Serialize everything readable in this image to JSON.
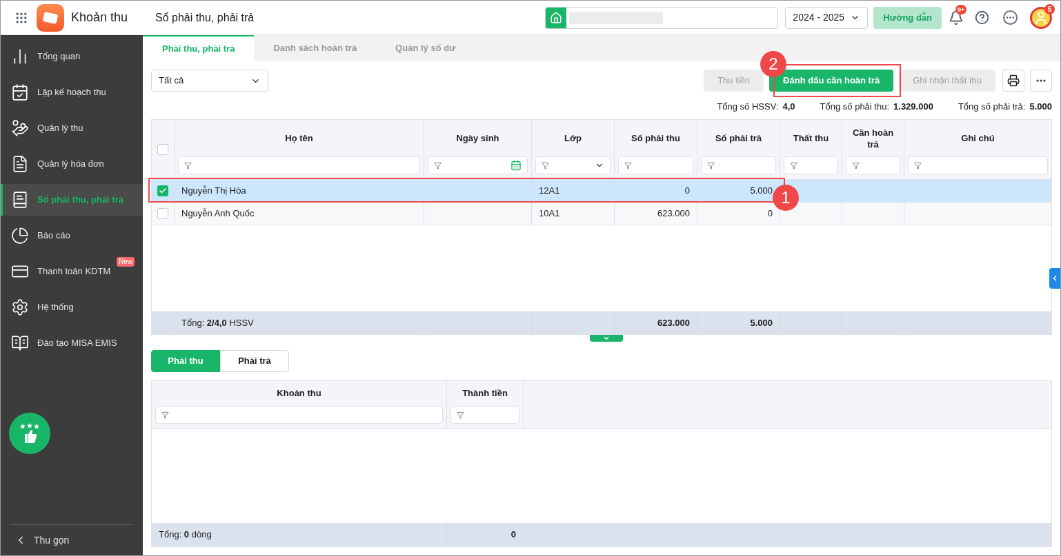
{
  "app": {
    "name": "Khoản thu",
    "page_title": "Sổ phải thu, phải trả"
  },
  "topbar": {
    "school_year": "2024 - 2025",
    "guide_button": "Hướng dẫn",
    "notification_badge": "9+",
    "avatar_badge": "5"
  },
  "sidebar": {
    "items": [
      {
        "label": "Tổng quan",
        "selected": false
      },
      {
        "label": "Lập kế hoạch thu",
        "selected": false
      },
      {
        "label": "Quản lý thu",
        "selected": false
      },
      {
        "label": "Quản lý hóa đơn",
        "selected": false
      },
      {
        "label": "Sổ phải thu, phải trả",
        "selected": true
      },
      {
        "label": "Báo cáo",
        "selected": false
      },
      {
        "label": "Thanh toán KDTM",
        "selected": false,
        "badge": "New"
      },
      {
        "label": "Hệ thống",
        "selected": false
      },
      {
        "label": "Đào tạo MISA EMIS",
        "selected": false
      }
    ],
    "collapse": "Thu gọn"
  },
  "tabs": [
    {
      "label": "Phải thu, phải trả",
      "selected": true
    },
    {
      "label": "Danh sách hoàn trả",
      "selected": false
    },
    {
      "label": "Quản lý số dư",
      "selected": false
    }
  ],
  "filter_select": "Tất cả",
  "actions": [
    {
      "label": "Thu tiền",
      "kind": "secondary",
      "disabled": true
    },
    {
      "label": "Đánh dấu cần hoàn trả",
      "kind": "primary",
      "disabled": false
    },
    {
      "label": "Ghi nhận thất thu",
      "kind": "secondary",
      "disabled": true
    }
  ],
  "summary": [
    {
      "label": "Tổng số HSSV:",
      "value": "4,0"
    },
    {
      "label": "Tổng số phải thu:",
      "value": "1.329.000"
    },
    {
      "label": "Tổng số phải trả:",
      "value": "5.000"
    }
  ],
  "table": {
    "select_all_checked": false,
    "columns": [
      "Họ tên",
      "Ngày sinh",
      "Lớp",
      "Số phải thu",
      "Số phải trả",
      "Thất thu",
      "Cần hoàn trả",
      "Ghi chú"
    ],
    "rows": [
      {
        "selected": true,
        "checked": true,
        "ho_ten": "Nguyễn Thị Hòa",
        "lop": "12A1",
        "so_phai_thu": "0",
        "so_phai_tra": "5.000"
      },
      {
        "selected": false,
        "checked": false,
        "ho_ten": "Nguyễn Anh Quốc",
        "lop": "10A1",
        "so_phai_thu": "623.000",
        "so_phai_tra": "0"
      }
    ],
    "footer": {
      "ho_ten": "Tổng: **2/4,0** HSSV",
      "so_phai_thu": "623.000",
      "so_phai_tra": "5.000"
    }
  },
  "detail_tabs": [
    {
      "label": "Phải thu",
      "selected": true
    },
    {
      "label": "Phải trả",
      "selected": false
    }
  ],
  "detail_table": {
    "columns": [
      "Khoản thu",
      "Thành tiền"
    ],
    "footer": {
      "label": "Tổng: **0** dòng",
      "total": "0"
    }
  },
  "callouts": [
    {
      "number": "1"
    },
    {
      "number": "2"
    }
  ]
}
